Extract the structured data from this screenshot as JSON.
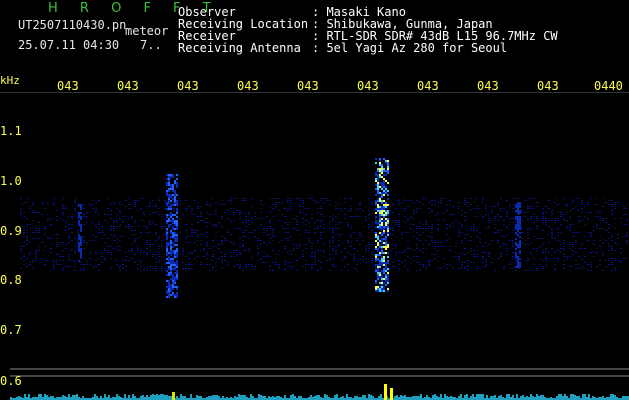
{
  "app": {
    "title": "H R O F F T"
  },
  "header": {
    "filename": "UT2507110430.pn",
    "tag": "meteor",
    "datetime": "25.07.11 04:30",
    "count": "7..",
    "fields": [
      {
        "label": "Observer",
        "value": ": Masaki Kano"
      },
      {
        "label": "Receiving Location",
        "value": ": Shibukawa, Gunma, Japan"
      },
      {
        "label": "Receiver",
        "value": ": RTL-SDR SDR# 43dB L15 96.7MHz CW"
      },
      {
        "label": "Receiving Antenna",
        "value": ": 5el Yagi Az 280 for Seoul"
      }
    ]
  },
  "axes": {
    "y_unit": "kHz",
    "y_ticks": [
      "1.1",
      "1.0",
      "0.9",
      "0.8",
      "0.7",
      "0.6"
    ],
    "x_ticks": [
      "043",
      "043",
      "043",
      "043",
      "043",
      "043",
      "043",
      "043",
      "043",
      "0440"
    ]
  },
  "colors": {
    "tick": "#ffff4a",
    "title": "#3fbf3f",
    "signal_low": "#0a1a9a",
    "signal_high": "#ffff00"
  }
}
